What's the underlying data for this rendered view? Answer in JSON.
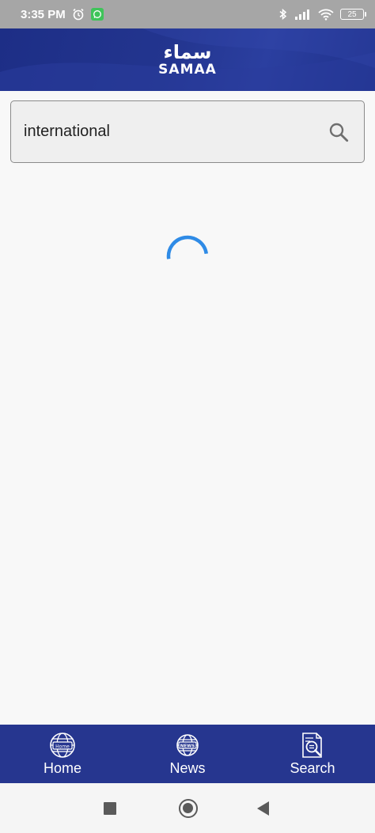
{
  "status_bar": {
    "time": "3:35 PM",
    "battery": "25"
  },
  "header": {
    "logo_urdu": "سماء",
    "logo_latin": "SAMAA"
  },
  "search": {
    "value": "international"
  },
  "bottom_nav": {
    "items": [
      {
        "label": "Home",
        "icon": "globe-home-icon",
        "icon_text": "Home"
      },
      {
        "label": "News",
        "icon": "globe-news-icon",
        "icon_text": "NEWS"
      },
      {
        "label": "Search",
        "icon": "document-search-icon"
      }
    ]
  },
  "system_nav": {
    "icons": [
      "recents-icon",
      "home-icon",
      "back-icon"
    ]
  },
  "colors": {
    "brand_blue": "#26368f",
    "spinner_blue": "#2f8be6",
    "status_bar": "#a6a6a6"
  }
}
